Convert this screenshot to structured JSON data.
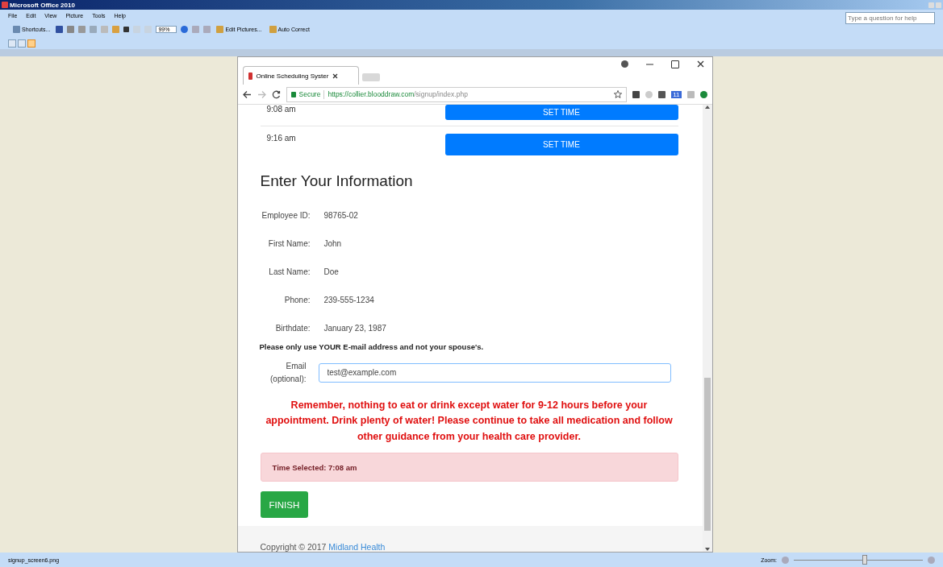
{
  "app": {
    "title": "Microsoft Office 2010",
    "help_placeholder": "Type a question for help"
  },
  "menu": [
    "File",
    "Edit",
    "View",
    "Picture",
    "Tools",
    "Help"
  ],
  "toolbar": {
    "shortcuts": "Shortcuts...",
    "zoom": "99%",
    "edit_pictures": "Edit Pictures...",
    "auto_correct": "Auto Correct"
  },
  "view_buttons": [
    {
      "selected": false
    },
    {
      "selected": false
    },
    {
      "selected": true
    }
  ],
  "browser": {
    "tab_title": "Online Scheduling Syster",
    "secure": "Secure",
    "url_host": "https://collier.blooddraw.com",
    "url_path": "/signup/index.php",
    "badge": "11"
  },
  "times": [
    {
      "time": "9:08 am",
      "button": "SET TIME"
    },
    {
      "time": "9:16 am",
      "button": "SET TIME"
    }
  ],
  "form": {
    "heading": "Enter Your Information",
    "fields": [
      {
        "label": "Employee ID:",
        "value": "98765-02"
      },
      {
        "label": "First Name:",
        "value": "John"
      },
      {
        "label": "Last Name:",
        "value": "Doe"
      },
      {
        "label": "Phone:",
        "value": "239-555-1234"
      },
      {
        "label": "Birthdate:",
        "value": "January 23, 1987"
      }
    ],
    "email_note": "Please only use YOUR E-mail address and not your spouse's.",
    "email_label": "Email (optional):",
    "email_value": "test@example.com",
    "warning": "Remember, nothing to eat or drink except water for 9-12 hours before your appointment. Drink plenty of water! Please continue to take all medication and follow other guidance from your health care provider.",
    "time_selected": "Time Selected: 7:08 am",
    "finish": "FINISH"
  },
  "footer": {
    "copyright": "Copyright © 2017",
    "link": "Midland Health"
  },
  "status": {
    "file": "signup_screen6.png",
    "zoom_label": "Zoom:",
    "zoom_slider": {
      "level": 0.55
    }
  }
}
